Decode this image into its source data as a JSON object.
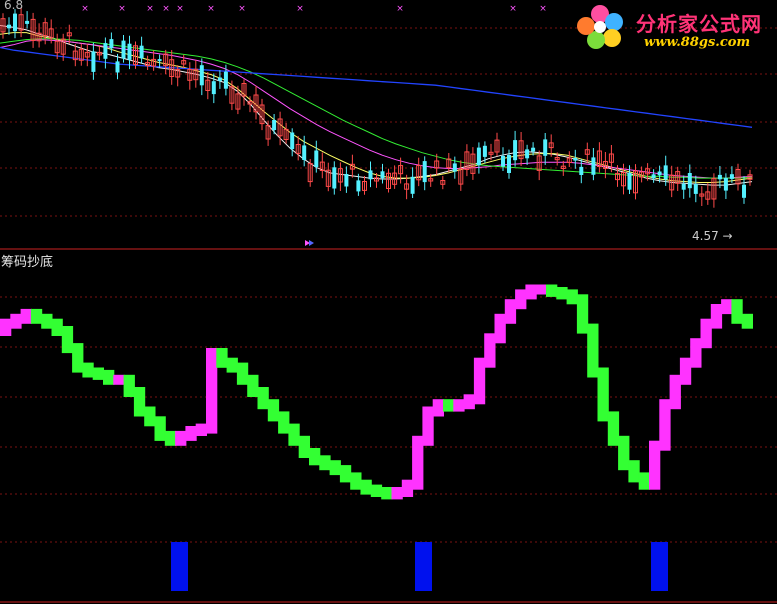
{
  "colors": {
    "background": "#000000",
    "divider": "#cc2222",
    "grid": "#7a1212",
    "up_candle": "#ff4a4a",
    "down_candle": "#54f0ff",
    "ma_white": "#f2f2f2",
    "ma_yellow": "#ffff66",
    "ma_magenta": "#ff55ff",
    "ma_green": "#33ee33",
    "ma_blue": "#2244ff",
    "indicator_rise": "#ff33ff",
    "indicator_fall": "#33ff33",
    "signal_bar": "#0011ee",
    "x_marker": "#ff55ff"
  },
  "watermark": {
    "brand": "分析家公式网",
    "url": "www.88gs.com",
    "icon": "flower-logo-icon"
  },
  "price_panel": {
    "top_label": "6.8",
    "low_marker": "4.57",
    "low_arrow": "→"
  },
  "indicator_panel": {
    "title": "筹码抄底"
  },
  "chart_data": [
    {
      "type": "candlestick",
      "panel": "price",
      "title": "",
      "ylim": [
        4.4,
        7.0
      ],
      "grid": true,
      "low_annotation": "4.57",
      "series": [
        {
          "name": "",
          "values": [
            6.8,
            6.78,
            6.75,
            6.7,
            6.66,
            6.6,
            6.55,
            6.5,
            6.48,
            6.44,
            6.4,
            6.36,
            6.32,
            6.3,
            6.27,
            6.24,
            6.2,
            6.15,
            6.05,
            5.9,
            5.72,
            5.55,
            5.4,
            5.28,
            5.18,
            5.12,
            5.1,
            5.08,
            5.06,
            5.05,
            5.05,
            5.06,
            5.08,
            5.1,
            5.14,
            5.18,
            5.22,
            5.28,
            5.32,
            5.35,
            5.36,
            5.35,
            5.33,
            5.3,
            5.26,
            5.22,
            5.18,
            5.14,
            5.1,
            5.06,
            5.03,
            5.01,
            5.0,
            4.99,
            4.98,
            4.98,
            5.0,
            5.02
          ]
        },
        {
          "name": "",
          "values": [
            6.7,
            6.72,
            6.72,
            6.68,
            6.65,
            6.62,
            6.6,
            6.58,
            6.55,
            6.5,
            6.46,
            6.42,
            6.38,
            6.35,
            6.32,
            6.28,
            6.24,
            6.18,
            6.08,
            5.95,
            5.82,
            5.7,
            5.58,
            5.48,
            5.4,
            5.32,
            5.25,
            5.18,
            5.12,
            5.08,
            5.06,
            5.06,
            5.07,
            5.09,
            5.12,
            5.16,
            5.2,
            5.24,
            5.28,
            5.31,
            5.33,
            5.34,
            5.34,
            5.32,
            5.28,
            5.24,
            5.2,
            5.16,
            5.12,
            5.08,
            5.05,
            5.03,
            5.02,
            5.01,
            5.01,
            5.02,
            5.04,
            5.06
          ]
        },
        {
          "name": "",
          "values": [
            6.55,
            6.58,
            6.62,
            6.64,
            6.63,
            6.62,
            6.6,
            6.58,
            6.56,
            6.54,
            6.52,
            6.5,
            6.48,
            6.46,
            6.43,
            6.4,
            6.36,
            6.31,
            6.24,
            6.15,
            6.05,
            5.95,
            5.85,
            5.76,
            5.67,
            5.59,
            5.52,
            5.45,
            5.38,
            5.32,
            5.27,
            5.23,
            5.2,
            5.18,
            5.17,
            5.17,
            5.18,
            5.19,
            5.21,
            5.22,
            5.23,
            5.24,
            5.24,
            5.24,
            5.23,
            5.21,
            5.19,
            5.17,
            5.15,
            5.13,
            5.11,
            5.09,
            5.08,
            5.07,
            5.06,
            5.06,
            5.07,
            5.08
          ]
        },
        {
          "name": "",
          "values": [
            6.6,
            6.62,
            6.64,
            6.65,
            6.65,
            6.64,
            6.63,
            6.61,
            6.59,
            6.57,
            6.55,
            6.53,
            6.51,
            6.49,
            6.47,
            6.45,
            6.42,
            6.38,
            6.33,
            6.27,
            6.2,
            6.12,
            6.04,
            5.96,
            5.88,
            5.8,
            5.72,
            5.65,
            5.58,
            5.51,
            5.45,
            5.4,
            5.35,
            5.31,
            5.27,
            5.24,
            5.22,
            5.2,
            5.19,
            5.18,
            5.17,
            5.16,
            5.15,
            5.14,
            5.13,
            5.12,
            5.11,
            5.1,
            5.09,
            5.08,
            5.08,
            5.07,
            5.07,
            5.06,
            5.06,
            5.06,
            5.06,
            5.07
          ]
        },
        {
          "name": "",
          "values": [
            6.55,
            6.52,
            6.5,
            6.48,
            6.46,
            6.44,
            6.42,
            6.4,
            6.38,
            6.36,
            6.35,
            6.34,
            6.33,
            6.32,
            6.31,
            6.3,
            6.29,
            6.28,
            6.27,
            6.26,
            6.25,
            6.24,
            6.23,
            6.22,
            6.21,
            6.2,
            6.19,
            6.18,
            6.17,
            6.16,
            6.15,
            6.14,
            6.13,
            6.12,
            6.1,
            6.08,
            6.06,
            6.04,
            6.02,
            6.0,
            5.98,
            5.96,
            5.94,
            5.92,
            5.9,
            5.88,
            5.86,
            5.84,
            5.82,
            5.8,
            5.78,
            5.76,
            5.74,
            5.72,
            5.7,
            5.68,
            5.66,
            5.64
          ]
        }
      ]
    },
    {
      "type": "line",
      "panel": "indicator",
      "title": "筹码抄底",
      "ylim": [
        0,
        100
      ],
      "grid": true,
      "series": [
        {
          "name": "",
          "values": [
            75,
            78,
            80,
            82,
            80,
            78,
            75,
            68,
            60,
            58,
            57,
            55,
            55,
            50,
            42,
            38,
            32,
            30,
            32,
            34,
            35,
            66,
            62,
            60,
            55,
            50,
            45,
            40,
            35,
            30,
            25,
            22,
            20,
            18,
            15,
            12,
            10,
            9,
            8,
            9,
            12,
            30,
            42,
            45,
            44,
            45,
            47,
            62,
            72,
            80,
            86,
            90,
            92,
            92,
            91,
            90,
            88,
            76,
            58,
            40,
            30,
            20,
            15,
            12,
            28,
            45,
            55,
            62,
            70,
            78,
            84,
            86,
            80,
            78
          ]
        }
      ]
    },
    {
      "type": "bar",
      "panel": "signal",
      "title": "",
      "categories": [
        "1",
        "2",
        "3"
      ],
      "values": [
        1,
        1,
        1
      ]
    }
  ]
}
